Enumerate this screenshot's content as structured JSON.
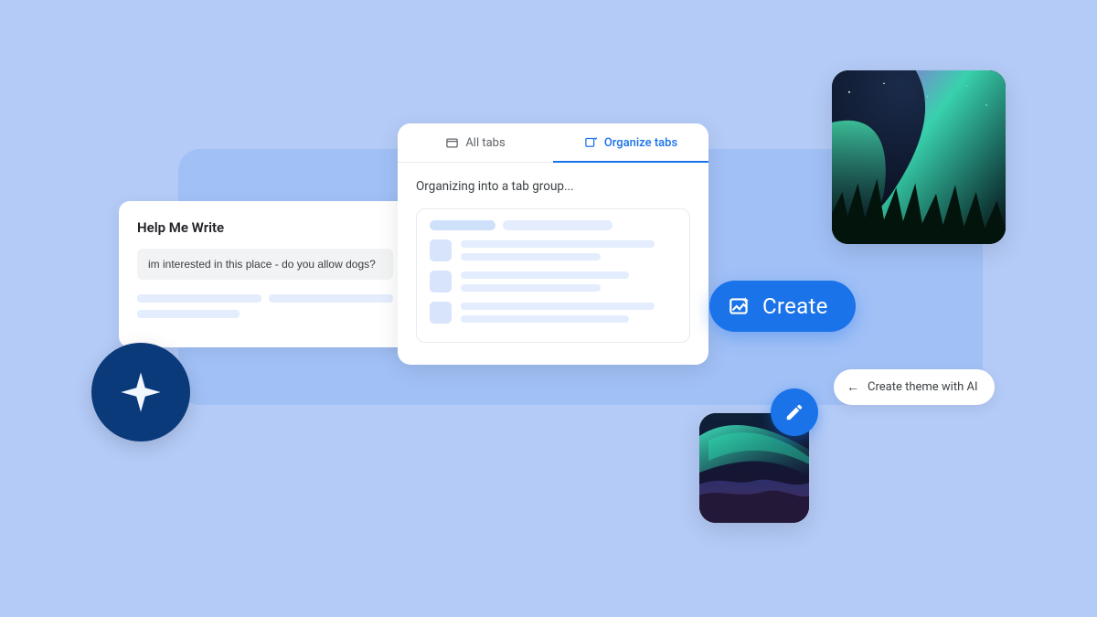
{
  "help_card": {
    "title": "Help Me Write",
    "input_value": "im interested in this place - do you allow dogs?"
  },
  "tabs_card": {
    "tab_all": "All tabs",
    "tab_organize": "Organize tabs",
    "status": "Organizing into a tab group..."
  },
  "create_button": {
    "label": "Create"
  },
  "theme_chip": {
    "label": "Create theme with AI"
  },
  "colors": {
    "primary": "#1a73e8",
    "bg": "#b4cbf7",
    "badge": "#0b3a7a"
  }
}
